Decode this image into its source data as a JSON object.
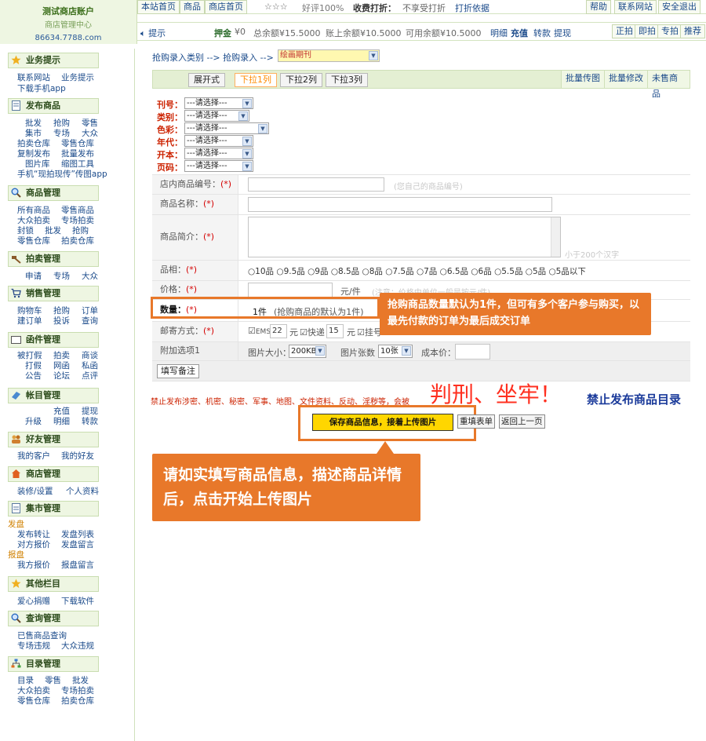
{
  "logo": {
    "line1": "测试商店账户",
    "line2": "商店管理中心",
    "line3": "86634.7788.com"
  },
  "topnav": {
    "left": [
      "本站首页",
      "商品",
      "商店首页"
    ],
    "rating_stars": "☆☆☆",
    "rating_text": "好评100%",
    "discount_label": "收费打折：",
    "discount_value": "不享受打折",
    "discount_link": "打折依据",
    "right": [
      "帮助",
      "联系网站",
      "安全退出"
    ]
  },
  "statusbar": {
    "tip": "提示",
    "deposit_label": "押金",
    "deposit_value": "¥0",
    "total_label": "总余额¥15.5000",
    "account_label": "账上余额¥10.5000",
    "available_label": "可用余额¥10.5000",
    "links": [
      "明细",
      "充值",
      "转款",
      "提现"
    ],
    "right": [
      "正拍",
      "即拍",
      "专拍",
      "推荐"
    ]
  },
  "sidebar": {
    "sections": [
      {
        "title": "业务提示",
        "icon": "star-icon",
        "lines": [
          [
            "联系网站",
            "业务提示"
          ],
          [
            "下载手机app"
          ]
        ]
      },
      {
        "title": "发布商品",
        "icon": "document-icon",
        "lines": [
          [
            "批发",
            "抢购",
            "零售"
          ],
          [
            "集市",
            "专场",
            "大众"
          ],
          [
            "拍卖仓库",
            "零售仓库"
          ],
          [
            "复制发布",
            "批量发布"
          ],
          [
            "图片库",
            "缩图工具"
          ],
          [
            "手机“现拍现传”传图app"
          ]
        ]
      },
      {
        "title": "商品管理",
        "icon": "magnifier-icon",
        "lines": [
          [
            "所有商品",
            "零售商品"
          ],
          [
            "大众拍卖",
            "专场拍卖"
          ],
          [
            "封锁",
            "批发",
            "抢购"
          ],
          [
            "零售仓库",
            "拍卖仓库"
          ]
        ]
      },
      {
        "title": "拍卖管理",
        "icon": "hammer-icon",
        "lines": [
          [
            "申请",
            "专场",
            "大众"
          ]
        ]
      },
      {
        "title": "销售管理",
        "icon": "cart-icon",
        "lines": [
          [
            "购物车",
            "抢购",
            "订单"
          ],
          [
            "建订单",
            "投诉",
            "查询"
          ]
        ]
      },
      {
        "title": "函件管理",
        "icon": "mail-icon",
        "lines": [
          [
            "被打假",
            "拍卖",
            "商谈"
          ],
          [
            "打假",
            "网函",
            "私函"
          ],
          [
            "公告",
            "论坛",
            "点评"
          ]
        ]
      },
      {
        "title": "帐目管理",
        "icon": "ledger-icon",
        "lines": [
          [
            "充值",
            "提现"
          ],
          [
            "升级",
            "明细",
            "转款"
          ]
        ]
      },
      {
        "title": "好友管理",
        "icon": "friends-icon",
        "lines": [
          [
            "我的客户",
            "我的好友"
          ]
        ]
      },
      {
        "title": "商店管理",
        "icon": "house-icon",
        "lines": [
          [
            "装修/设置",
            "个人资料"
          ]
        ]
      },
      {
        "title": "集市管理",
        "icon": "clipboard-icon",
        "lines": [
          [
            "发盘"
          ],
          [
            "发布转让",
            "发盘列表"
          ],
          [
            "对方报价",
            "发盘留言"
          ],
          [
            "报盘"
          ],
          [
            "我方报价",
            "报盘留言"
          ]
        ]
      },
      {
        "title": "其他栏目",
        "icon": "star-icon",
        "lines": [
          [
            "爱心捐赠",
            "下载软件"
          ]
        ]
      },
      {
        "title": "查询管理",
        "icon": "magnifier-icon",
        "lines": [
          [
            "已售商品查询"
          ],
          [
            "专场违规",
            "大众违规"
          ]
        ]
      },
      {
        "title": "目录管理",
        "icon": "tree-icon",
        "lines": [
          [
            "目录",
            "零售",
            "批发"
          ],
          [
            "大众拍卖",
            "专场拍卖"
          ],
          [
            "零售仓库",
            "拍卖仓库"
          ]
        ]
      }
    ]
  },
  "main": {
    "breadcrumb": "抢购录入类别 --> 抢购录入 -->",
    "breadcrumb_select": "绘画期刊",
    "tabs": [
      "展开式",
      "下拉1列",
      "下拉2列",
      "下拉3列"
    ],
    "right_buttons": [
      "批量传图",
      "批量修改",
      "未售商品"
    ],
    "filters": [
      {
        "label": "刊号：",
        "value": "---请选择---"
      },
      {
        "label": "类别：",
        "value": "---请选择---"
      },
      {
        "label": "色彩：",
        "value": "---请选择---"
      },
      {
        "label": "年代：",
        "value": "---请选择---"
      },
      {
        "label": "开本：",
        "value": "---请选择---"
      },
      {
        "label": "页码：",
        "value": "---请选择---"
      }
    ],
    "fields": {
      "store_no": {
        "label": "店内商品编号：",
        "req": "(*)",
        "placeholder": "(您自己的商品编号)"
      },
      "name": {
        "label": "商品名称：",
        "req": "(*)"
      },
      "intro": {
        "label": "商品简介：",
        "req": "(*)",
        "placeholder": "小于200个汉字"
      },
      "grade": {
        "label": "品相：",
        "req": "(*)",
        "options": [
          "10品",
          "9.5品",
          "9品",
          "8.5品",
          "8品",
          "7.5品",
          "7品",
          "6.5品",
          "6品",
          "5.5品",
          "5品",
          "5品以下"
        ]
      },
      "price": {
        "label": "价格：",
        "req": "(*)",
        "unit": "元/件",
        "hint": "(注意：价格中单位一般是按元/件)"
      },
      "qty": {
        "label": "数量：",
        "req": "(*)",
        "value": "1件",
        "note": "(抢购商品的默认为1件)"
      },
      "shipping": {
        "label": "邮寄方式：",
        "req": "(*)",
        "ems": "EMS",
        "ems_price": "22",
        "yuan": "元",
        "express": "快递",
        "express_price": "15",
        "registered": "挂号"
      },
      "extra": {
        "label": "附加选项1",
        "img_size_label": "图片大小：",
        "img_size": "200KB",
        "img_count_label": "图片张数",
        "img_count": "10张",
        "cost_label": "成本价："
      },
      "note_button": "填写备注"
    },
    "warning": {
      "small": "禁止发布涉密、机密、秘密、军事、地图、文件资料、反动、淫秽等，会被",
      "big": "判刑、坐牢！",
      "link": "禁止发布商品目录"
    },
    "buttons": {
      "save": "保存商品信息，接着上传图片",
      "reset": "重填表单",
      "back": "返回上一页"
    },
    "callout_qty": "抢购商品数量默认为1件，但可有多个客户参与购买，以最先付款的订单为最后成交订单",
    "callout_save": "请如实填写商品信息，描述商品详情后，点击开始上传图片"
  }
}
